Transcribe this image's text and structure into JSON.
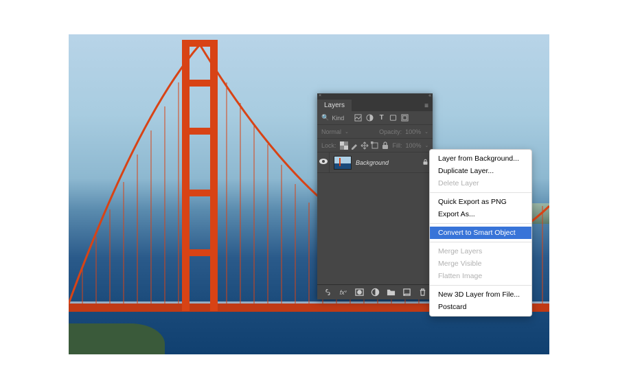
{
  "panel": {
    "title": "Layers",
    "kind_label": "Kind",
    "blend_mode": "Normal",
    "opacity_label": "Opacity:",
    "opacity_value": "100%",
    "lock_label": "Lock:",
    "fill_label": "Fill:",
    "fill_value": "100%"
  },
  "layer": {
    "name": "Background"
  },
  "menu": {
    "items": [
      {
        "label": "Layer from Background...",
        "enabled": true
      },
      {
        "label": "Duplicate Layer...",
        "enabled": true
      },
      {
        "label": "Delete Layer",
        "enabled": false
      },
      {
        "sep": true
      },
      {
        "label": "Quick Export as PNG",
        "enabled": true
      },
      {
        "label": "Export As...",
        "enabled": true
      },
      {
        "sep": true
      },
      {
        "label": "Convert to Smart Object",
        "enabled": true,
        "highlighted": true
      },
      {
        "sep": true
      },
      {
        "label": "Merge Layers",
        "enabled": false
      },
      {
        "label": "Merge Visible",
        "enabled": false
      },
      {
        "label": "Flatten Image",
        "enabled": false
      },
      {
        "sep": true
      },
      {
        "label": "New 3D Layer from File...",
        "enabled": true
      },
      {
        "label": "Postcard",
        "enabled": true
      }
    ]
  }
}
